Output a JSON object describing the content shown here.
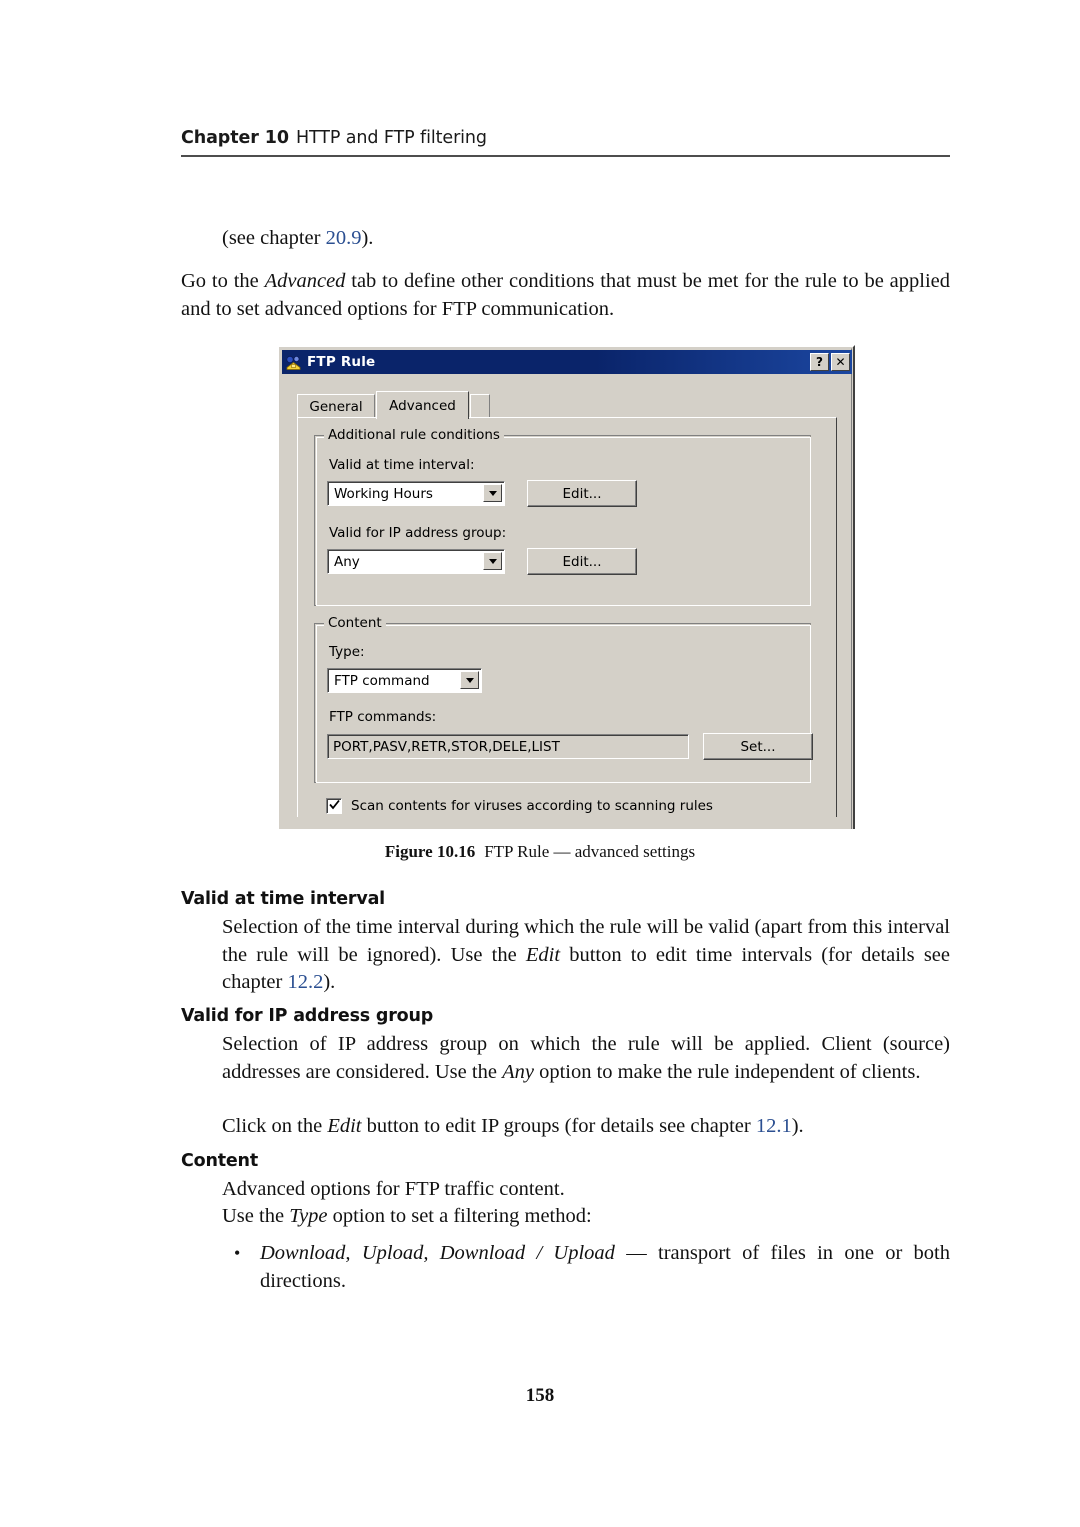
{
  "header": {
    "chapter": "Chapter 10",
    "title": "HTTP and FTP filtering"
  },
  "body": {
    "see_chapter_pre": "(see chapter ",
    "see_chapter_ref": "20.9",
    "see_chapter_post": ").",
    "intro_1": "Go to the ",
    "intro_2": "Advanced",
    "intro_3": " tab to define other conditions that must be met for the rule to be applied and to set advanced options for FTP communication."
  },
  "figure": {
    "caption_label": "Figure 10.16",
    "caption_text": "FTP Rule — advanced settings"
  },
  "dialog": {
    "title": "FTP Rule",
    "icon": "ftp-rule-icon",
    "help_button": "?",
    "close_button": "✕",
    "tabs": [
      {
        "label": "General",
        "active": false
      },
      {
        "label": "Advanced",
        "active": true
      }
    ],
    "group_conditions": {
      "legend": "Additional rule conditions",
      "time_interval_label": "Valid at time interval:",
      "time_interval_value": "Working Hours",
      "time_interval_edit": "Edit...",
      "ip_group_label": "Valid for IP address group:",
      "ip_group_value": "Any",
      "ip_group_edit": "Edit..."
    },
    "group_content": {
      "legend": "Content",
      "type_label": "Type:",
      "type_value": "FTP command",
      "commands_label": "FTP commands:",
      "commands_value": "PORT,PASV,RETR,STOR,DELE,LIST",
      "commands_set_button": "Set..."
    },
    "scan_checkbox": {
      "label": "Scan contents for viruses according to scanning rules",
      "checked": true
    }
  },
  "sections": [
    {
      "heading": "Valid at time interval",
      "para_a": "Selection of the time interval during which the rule will be valid (apart from this interval the rule will be ignored).  Use the ",
      "para_em": "Edit",
      "para_b": " button to edit time intervals (for details see chapter ",
      "para_ref": "12.2",
      "para_c": ")."
    },
    {
      "heading": "Valid for IP address group",
      "para_a": "Selection of IP address group on which the rule will be applied.  Client (source) addresses are considered.  Use the ",
      "para_em": "Any",
      "para_b": " option to make the rule independent of clients.",
      "para2_a": "Click on the ",
      "para2_em": "Edit",
      "para2_b": " button to edit IP groups (for details see chapter ",
      "para2_ref": "12.1",
      "para2_c": ")."
    },
    {
      "heading": "Content",
      "para_a": "Advanced options for FTP traffic content.",
      "para2_a": "Use the ",
      "para2_em": "Type",
      "para2_b": " option to set a filtering method:",
      "bullet_em": "Download, Upload, Download / Upload",
      "bullet_text": " — transport of files in one or both directions."
    }
  ],
  "page_number": "158",
  "colors": {
    "xref": "#2b4f91",
    "dialog_face": "#d4d0c8",
    "titlebar": "#0a246a"
  }
}
